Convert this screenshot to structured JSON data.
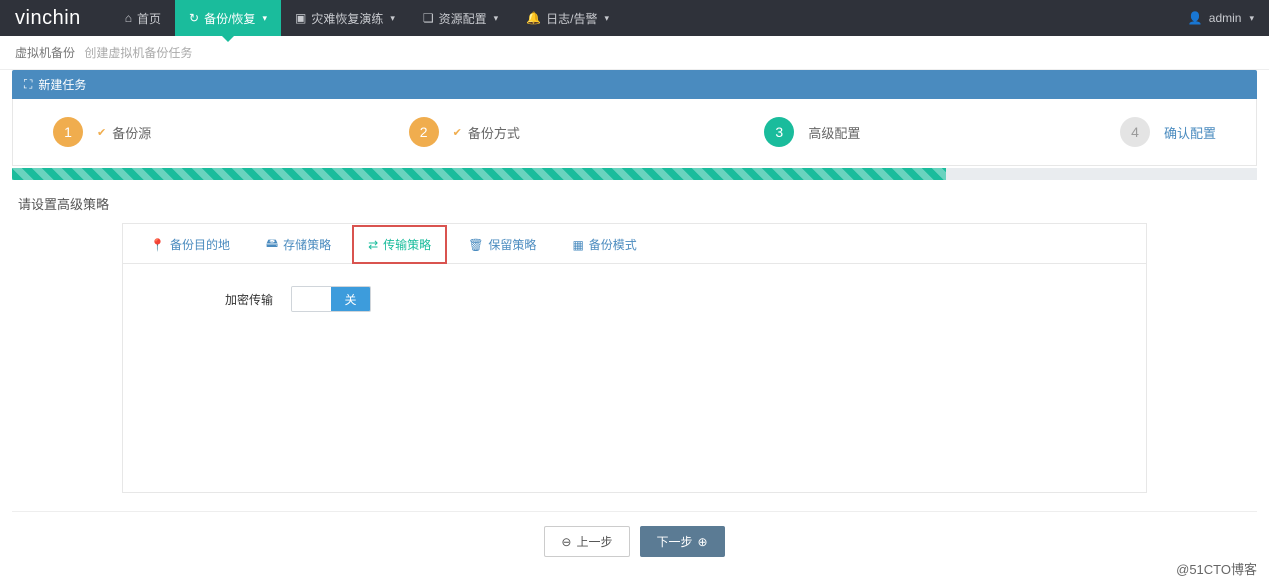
{
  "brand": "vinchin",
  "nav": {
    "home": "首页",
    "backup": "备份/恢复",
    "dr": "灾难恢复演练",
    "resource": "资源配置",
    "log": "日志/告警"
  },
  "user": {
    "name": "admin"
  },
  "breadcrumb": {
    "main": "虚拟机备份",
    "sub": "创建虚拟机备份任务"
  },
  "panel": {
    "title": "新建任务"
  },
  "steps": {
    "s1": {
      "num": "1",
      "label": "备份源"
    },
    "s2": {
      "num": "2",
      "label": "备份方式"
    },
    "s3": {
      "num": "3",
      "label": "高级配置"
    },
    "s4": {
      "num": "4",
      "label": "确认配置"
    }
  },
  "section": {
    "heading": "请设置高级策略"
  },
  "tabs": {
    "dest": "备份目的地",
    "storage": "存储策略",
    "transfer": "传输策略",
    "retain": "保留策略",
    "mode": "备份模式"
  },
  "form": {
    "encrypt_label": "加密传输",
    "toggle_off": "关"
  },
  "buttons": {
    "prev": "上一步",
    "next": "下一步"
  },
  "watermark": "@51CTO博客"
}
